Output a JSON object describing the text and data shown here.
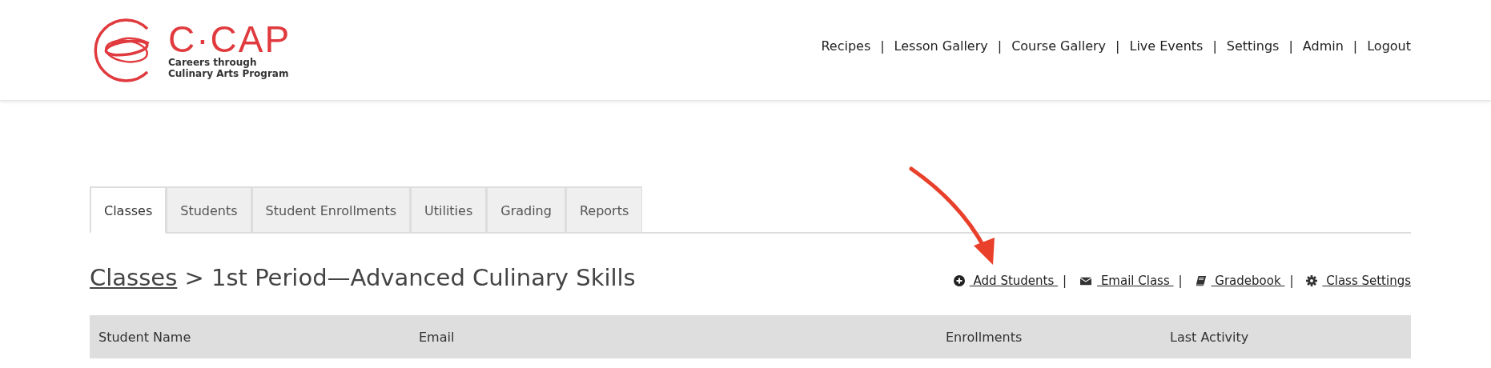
{
  "logo": {
    "name": "C·CAP",
    "tagline_lines": [
      "Careers through",
      "Culinary Arts Program"
    ]
  },
  "nav": {
    "separator": "|",
    "items": [
      "Recipes",
      "Lesson Gallery",
      "Course Gallery",
      "Live Events",
      "Settings",
      "Admin",
      "Logout"
    ]
  },
  "tabs": [
    {
      "label": "Classes",
      "selected": true
    },
    {
      "label": "Students",
      "selected": false
    },
    {
      "label": "Student Enrollments",
      "selected": false
    },
    {
      "label": "Utilities",
      "selected": false
    },
    {
      "label": "Grading",
      "selected": false
    },
    {
      "label": "Reports",
      "selected": false
    }
  ],
  "breadcrumb": {
    "link": "Classes",
    "rest": "> 1st Period—Advanced Culinary Skills"
  },
  "actions": {
    "separator": "|",
    "items": [
      {
        "kind": "add",
        "label": " Add Students "
      },
      {
        "kind": "email",
        "label": " Email Class "
      },
      {
        "kind": "book",
        "label": " Gradebook "
      },
      {
        "kind": "gear",
        "label": " Class Settings"
      }
    ]
  },
  "annotation": {
    "kind": "arrow"
  },
  "table": {
    "columns": [
      "Student Name",
      "Email",
      "Enrollments",
      "Last Activity"
    ]
  }
}
